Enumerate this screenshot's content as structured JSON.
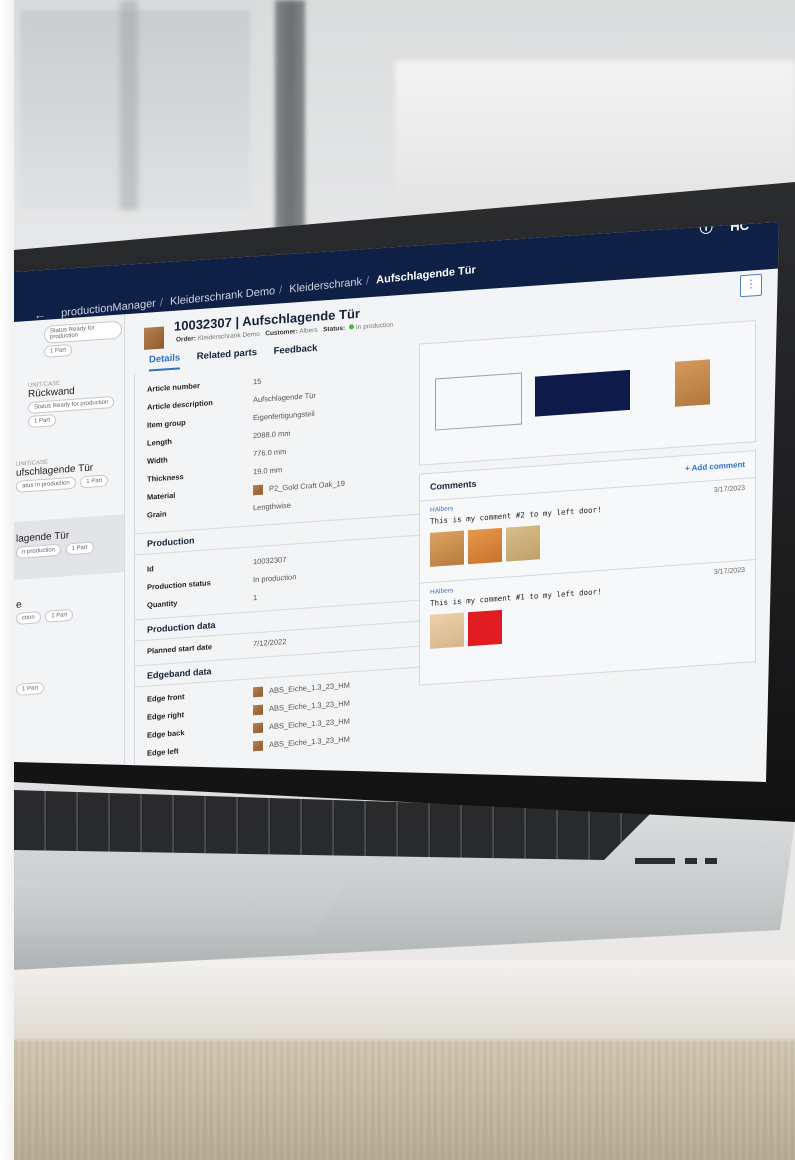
{
  "app": {
    "breadcrumb": [
      "productionManager",
      "Kleiderschrank Demo",
      "Kleiderschrank"
    ],
    "breadcrumb_current": "Aufschlagende Tür",
    "brand_logo": "HC",
    "help_icon": "help-circle-icon",
    "colors": {
      "topbar": "#0f2046",
      "accent": "#2d72c9",
      "status_green": "#4caf50"
    }
  },
  "sidebar": {
    "items": [
      {
        "kind": "",
        "name": "",
        "status": "Status Ready for production",
        "parts": "1 Part"
      },
      {
        "kind": "UNIT/CASE",
        "name": "Rückwand",
        "status": "Status Ready for production",
        "parts": "1 Part"
      },
      {
        "kind": "UNIT/CASE",
        "name": "ufschlagende Tür",
        "status": "atus In production",
        "parts": "1 Part"
      },
      {
        "kind": "",
        "name": "lagende Tür",
        "status": "n production",
        "parts": "1 Part"
      },
      {
        "kind": "",
        "name": "e",
        "status": "ction",
        "parts": "1 Part"
      },
      {
        "kind": "",
        "name": "",
        "status": "",
        "parts": "1 Part"
      }
    ]
  },
  "header": {
    "title": "10032307 | Aufschlagende Tür",
    "order_label": "Order:",
    "order_value": "Kleiderschrank Demo",
    "customer_label": "Customer:",
    "customer_value": "Albers",
    "status_label": "Status:",
    "status_value": "In production"
  },
  "tabs": [
    "Details",
    "Related parts",
    "Feedback"
  ],
  "details": {
    "rows": [
      {
        "key": "Article number",
        "value": "15"
      },
      {
        "key": "Article description",
        "value": "Aufschlagende Tür"
      },
      {
        "key": "Item group",
        "value": "Eigenfertigungsteil"
      },
      {
        "key": "Length",
        "value": "2088.0 mm"
      },
      {
        "key": "Width",
        "value": "776.0 mm"
      },
      {
        "key": "Thickness",
        "value": "19.0 mm"
      },
      {
        "key": "Material",
        "value": "P2_Gold Craft Oak_19"
      },
      {
        "key": "Grain",
        "value": "Lengthwise"
      }
    ]
  },
  "production": {
    "heading": "Production",
    "rows": [
      {
        "key": "Id",
        "value": "10032307"
      },
      {
        "key": "Production status",
        "value": "In production"
      },
      {
        "key": "Quantity",
        "value": "1"
      }
    ]
  },
  "production_data": {
    "heading": "Production data",
    "rows": [
      {
        "key": "Planned start date",
        "value": "7/12/2022"
      }
    ]
  },
  "edgeband": {
    "heading": "Edgeband data",
    "rows": [
      {
        "key": "Edge front",
        "value": "ABS_Eiche_1.3_23_HM"
      },
      {
        "key": "Edge right",
        "value": "ABS_Eiche_1.3_23_HM"
      },
      {
        "key": "Edge back",
        "value": "ABS_Eiche_1.3_23_HM"
      },
      {
        "key": "Edge left",
        "value": "ABS_Eiche_1.3_23_HM"
      }
    ]
  },
  "comments": {
    "heading": "Comments",
    "add_label": "Add comment",
    "items": [
      {
        "user": "HAlbers",
        "date": "3/17/2023",
        "text": "This is my comment #2 to my left door!",
        "images": [
          "#c8934f",
          "#d9843a",
          "#c9ad78"
        ]
      },
      {
        "user": "HAlbers",
        "date": "3/17/2023",
        "text": "This is my comment #1 to my left door!",
        "images": [
          "#e2c49a",
          "#e11b22"
        ]
      }
    ]
  }
}
